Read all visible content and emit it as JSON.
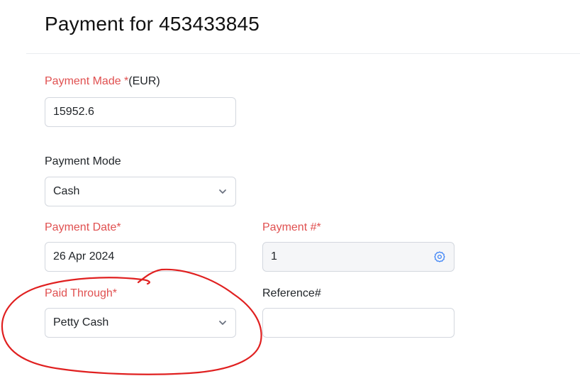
{
  "header": {
    "title": "Payment for 453433845"
  },
  "form": {
    "payment_made": {
      "label": "Payment Made *",
      "currency_suffix": "(EUR)",
      "value": "15952.6"
    },
    "payment_mode": {
      "label": "Payment Mode",
      "value": "Cash"
    },
    "payment_date": {
      "label": "Payment Date*",
      "value": "26 Apr 2024"
    },
    "payment_number": {
      "label": "Payment #*",
      "value": "1"
    },
    "paid_through": {
      "label": "Paid Through*",
      "value": "Petty Cash"
    },
    "reference": {
      "label": "Reference#",
      "value": ""
    }
  },
  "colors": {
    "required_label": "#e05050",
    "accent_icon": "#3b82f6",
    "annotation_ink": "#e02020"
  },
  "icons": {
    "dropdown": "chevron-down-icon",
    "settings": "gear-icon"
  }
}
